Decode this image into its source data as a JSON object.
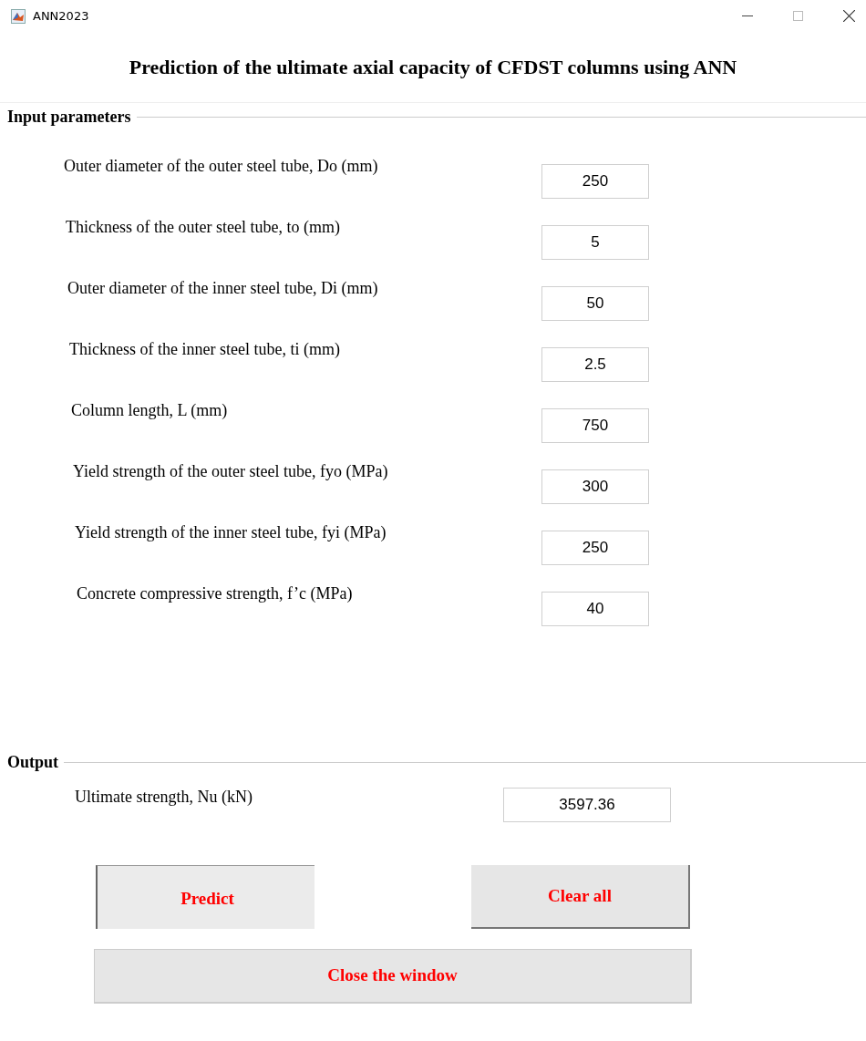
{
  "window": {
    "title": "ANN2023"
  },
  "heading": "Prediction of the ultimate axial capacity of CFDST columns using ANN",
  "inputs": {
    "title": "Input parameters",
    "fields": [
      {
        "label": "Outer diameter of the outer steel tube, Do (mm)",
        "value": "250"
      },
      {
        "label": "Thickness of the outer steel tube, to (mm)",
        "value": "5"
      },
      {
        "label": "Outer diameter of the inner steel tube, Di (mm)",
        "value": "50"
      },
      {
        "label": "Thickness of the inner steel tube, ti (mm)",
        "value": "2.5"
      },
      {
        "label": "Column length, L (mm)",
        "value": "750"
      },
      {
        "label": "Yield strength of the outer steel tube, fyo (MPa)",
        "value": "300"
      },
      {
        "label": "Yield strength of the inner steel tube, fyi (MPa)",
        "value": "250"
      },
      {
        "label": "Concrete compressive strength, f’c (MPa)",
        "value": "40"
      }
    ]
  },
  "output": {
    "title": "Output",
    "label": "Ultimate strength, Nu (kN)",
    "value": "3597.36"
  },
  "buttons": [
    {
      "label": "Predict",
      "pressed": true
    },
    {
      "label": "Clear all",
      "pressed": false
    },
    {
      "label": "Close the window",
      "pressed": false
    }
  ]
}
